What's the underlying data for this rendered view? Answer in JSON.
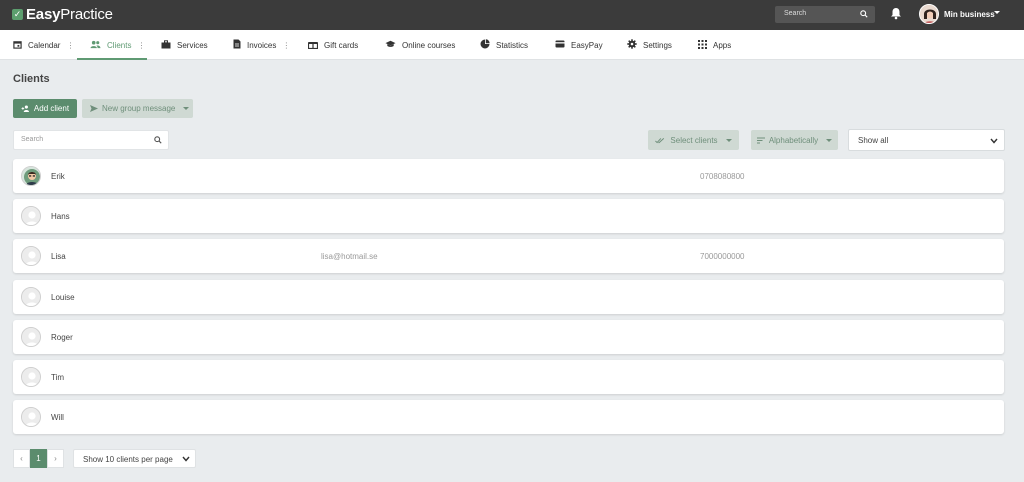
{
  "app": {
    "logo_bold": "Easy",
    "logo_light": "Practice",
    "search_placeholder": "Search",
    "user_name": "Min business"
  },
  "nav": {
    "items": [
      {
        "label": "Calendar",
        "icon": "calendar-icon"
      },
      {
        "label": "Clients",
        "icon": "clients-icon"
      },
      {
        "label": "Services",
        "icon": "briefcase-icon"
      },
      {
        "label": "Invoices",
        "icon": "document-icon"
      },
      {
        "label": "Gift cards",
        "icon": "gift-icon"
      },
      {
        "label": "Online courses",
        "icon": "graduation-cap-icon"
      },
      {
        "label": "Statistics",
        "icon": "pie-chart-icon"
      },
      {
        "label": "EasyPay",
        "icon": "credit-card-icon"
      },
      {
        "label": "Settings",
        "icon": "gear-icon"
      },
      {
        "label": "Apps",
        "icon": "grid-icon"
      }
    ],
    "active": "Clients"
  },
  "page": {
    "title": "Clients",
    "add_client_label": "Add client",
    "group_message_label": "New group message",
    "search_placeholder": "Search",
    "select_clients_label": "Select clients",
    "sort_label": "Alphabetically",
    "filter_value": "Show all"
  },
  "clients": [
    {
      "name": "Erik",
      "email": "",
      "phone": "0708080800"
    },
    {
      "name": "Hans",
      "email": "",
      "phone": ""
    },
    {
      "name": "Lisa",
      "email": "lisa@hotmail.se",
      "phone": "7000000000"
    },
    {
      "name": "Louise",
      "email": "",
      "phone": ""
    },
    {
      "name": "Roger",
      "email": "",
      "phone": ""
    },
    {
      "name": "Tim",
      "email": "",
      "phone": ""
    },
    {
      "name": "Will",
      "email": "",
      "phone": ""
    }
  ],
  "pagination": {
    "current_page": "1",
    "prev": "‹",
    "next": "›",
    "per_page_label": "Show 10 clients per page"
  },
  "colors": {
    "topbar": "#3b3b3b",
    "accent": "#5b8c6d",
    "muted_button": "#cfd9d3"
  }
}
